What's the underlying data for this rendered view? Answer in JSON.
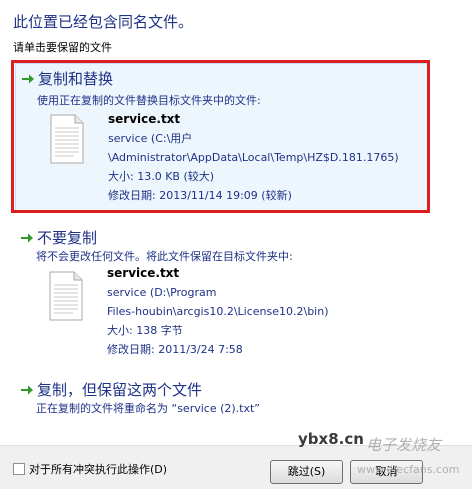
{
  "header": {
    "title": "此位置已经包含同名文件。",
    "subtitle": "请单击要保留的文件"
  },
  "options": [
    {
      "title": "复制和替换",
      "description": "使用正在复制的文件替换目标文件夹中的文件:",
      "file": {
        "name": "service.txt",
        "lines": [
          "service (C:\\用户",
          "\\Administrator\\AppData\\Local\\Temp\\HZ$D.181.1765)",
          "大小: 13.0 KB (较大)",
          "修改日期: 2013/11/14 19:09 (较新)"
        ]
      }
    },
    {
      "title": "不要复制",
      "description": "将不会更改任何文件。将此文件保留在目标文件夹中:",
      "file": {
        "name": "service.txt",
        "lines": [
          "service (D:\\Program",
          "Files-houbin\\arcgis10.2\\License10.2\\bin)",
          "大小: 138 字节",
          "修改日期: 2011/3/24 7:58"
        ]
      }
    },
    {
      "title": "复制，但保留这两个文件",
      "description": "正在复制的文件将重命名为 “service (2).txt”"
    }
  ],
  "footer": {
    "checkbox_label": "对于所有冲突执行此操作(D)",
    "skip_label": "跳过(S)",
    "cancel_label": "取消"
  },
  "watermark": {
    "site": "ybx8.cn",
    "brand": "电子发烧友",
    "url": "www.elecfans.com"
  },
  "colors": {
    "title_blue": "#1e3287",
    "selected_bg": "#eef6fd",
    "highlight_red": "#dc1e1e",
    "arrow_green": "#2e9a2e"
  }
}
